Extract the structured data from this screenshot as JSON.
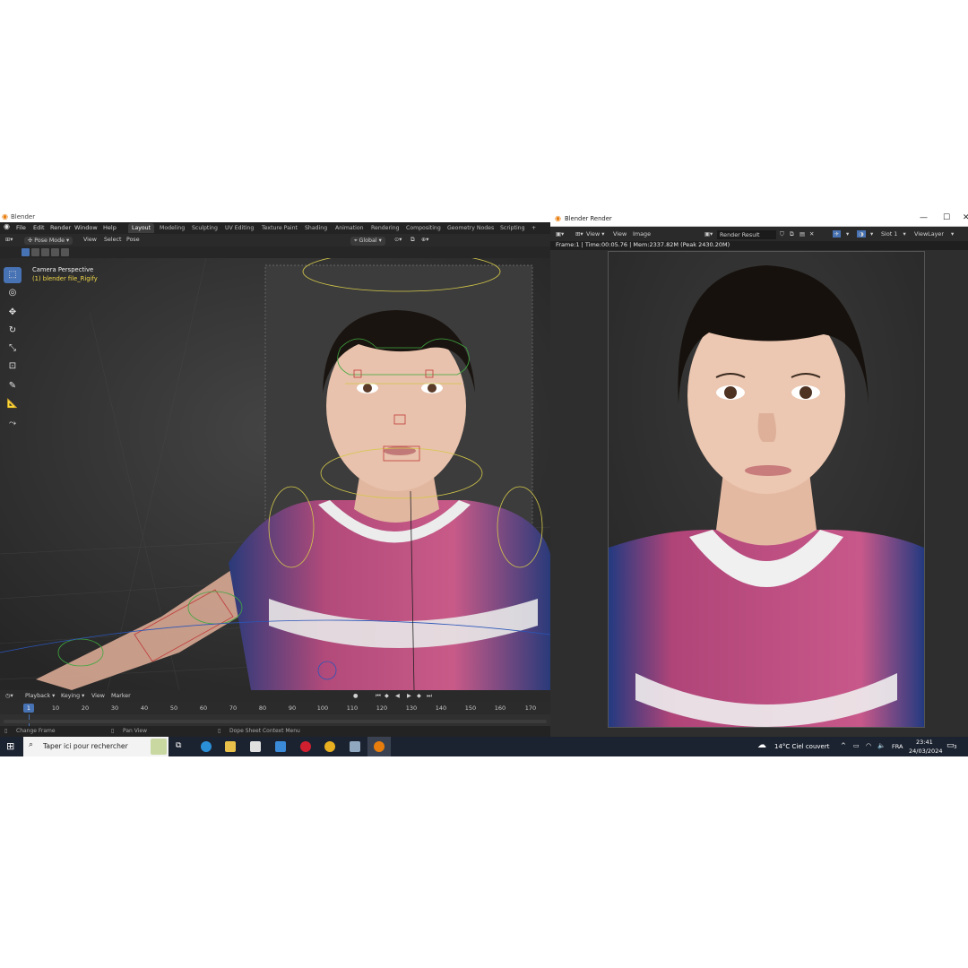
{
  "blender": {
    "window_title": "Blender",
    "menu": [
      "File",
      "Edit",
      "Render",
      "Window",
      "Help"
    ],
    "workspaces": [
      "Layout",
      "Modeling",
      "Sculpting",
      "UV Editing",
      "Texture Paint",
      "Shading",
      "Animation",
      "Rendering",
      "Compositing",
      "Geometry Nodes",
      "Scripting"
    ],
    "active_workspace": "Layout",
    "add_tab": "+",
    "header": {
      "mode": "Pose Mode",
      "view": "View",
      "select": "Select",
      "pose": "Pose",
      "orientation": "Global"
    },
    "viewport": {
      "camera_label": "Camera Perspective",
      "object_label": "(1) blender file_Rigify"
    },
    "timeline": {
      "playback": "Playback",
      "keying": "Keying",
      "view": "View",
      "marker": "Marker",
      "current_frame": "1",
      "ticks": [
        "10",
        "20",
        "30",
        "40",
        "50",
        "60",
        "70",
        "80",
        "90",
        "100",
        "110",
        "120",
        "130",
        "140",
        "150",
        "160",
        "170"
      ]
    },
    "status": {
      "left": "Change Frame",
      "middle": "Pan View",
      "right": "Dope Sheet Context Menu"
    }
  },
  "render_window": {
    "title": "Blender Render",
    "view": "View",
    "view2": "View",
    "image": "Image",
    "image_name": "Render Result",
    "slot": "Slot 1",
    "view_layer": "ViewLayer",
    "info": "Frame:1 | Time:00:05.76 | Mem:2337.82M (Peak 2430.20M)"
  },
  "taskbar": {
    "search_placeholder": "Taper ici pour rechercher",
    "weather": "14°C  Ciel couvert",
    "language": "FRA",
    "time": "23:41",
    "date": "24/03/2024",
    "notifications": "3"
  },
  "colors": {
    "accent": "#4772b3",
    "rig_yellow": "#d4c84a",
    "rig_red": "#c03a3a",
    "rig_green": "#3fa83f"
  }
}
